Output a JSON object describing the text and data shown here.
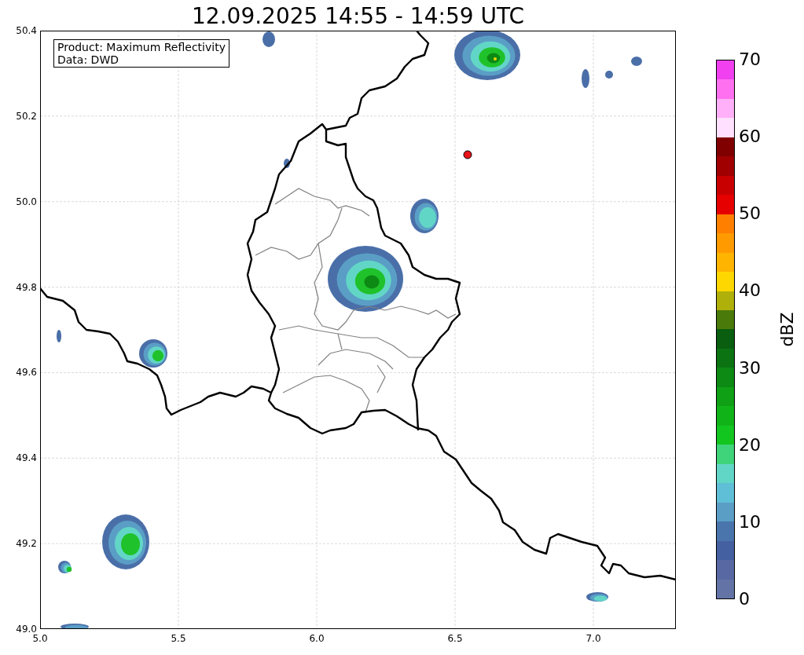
{
  "title": "12.09.2025 14:55 - 14:59 UTC",
  "info_box": [
    "Product: Maximum Reflectivity",
    "Data: DWD"
  ],
  "x_ticks": [
    "5.0",
    "5.5",
    "6.0",
    "6.5",
    "7.0"
  ],
  "y_ticks": [
    "50.4",
    "50.2",
    "50.0",
    "49.8",
    "49.6",
    "49.4",
    "49.2",
    "49.0"
  ],
  "colorbar": {
    "label": "dBZ",
    "ticks": [
      "70",
      "60",
      "50",
      "40",
      "30",
      "20",
      "10",
      "0"
    ],
    "segments": [
      {
        "color": "#6373a6"
      },
      {
        "color": "#5868a2"
      },
      {
        "color": "#4560a0"
      },
      {
        "color": "#4a74ac"
      },
      {
        "color": "#5a9ec6"
      },
      {
        "color": "#5fbfd6"
      },
      {
        "color": "#62d6c6"
      },
      {
        "color": "#3fd37a"
      },
      {
        "color": "#12c61f"
      },
      {
        "color": "#10b418"
      },
      {
        "color": "#0fa016"
      },
      {
        "color": "#0c8a14"
      },
      {
        "color": "#0b7312"
      },
      {
        "color": "#095e0f"
      },
      {
        "color": "#4a7a0a"
      },
      {
        "color": "#b0b00a"
      },
      {
        "color": "#ffd700"
      },
      {
        "color": "#ffb400"
      },
      {
        "color": "#ff9a00"
      },
      {
        "color": "#ff7f00"
      },
      {
        "color": "#e60000"
      },
      {
        "color": "#c80000"
      },
      {
        "color": "#a00000"
      },
      {
        "color": "#800000"
      },
      {
        "color": "#ffe0ff"
      },
      {
        "color": "#ffb0f8"
      },
      {
        "color": "#ff70f0"
      },
      {
        "color": "#f040f0"
      }
    ]
  }
}
